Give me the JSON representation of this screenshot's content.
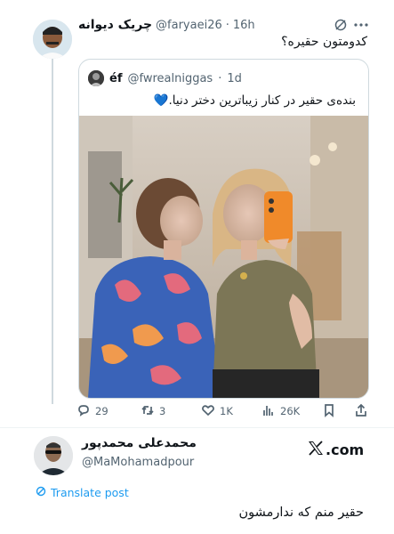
{
  "post": {
    "display_name": "چریک دیوانه",
    "handle": "@faryaei26",
    "separator": "·",
    "time": "16h",
    "text": "کدومتون حقیره؟",
    "grok_icon": "grok-icon",
    "more_icon": "more-dots-icon"
  },
  "quote": {
    "display_name": "éf",
    "handle": "@fwrealniggas",
    "separator": "·",
    "time": "1d",
    "text": "بنده‌ی حقیر در کنار زیباترین دختر دنیا.💙"
  },
  "actions": {
    "replies": "29",
    "reposts": "3",
    "likes": "1K",
    "views": "26K",
    "icons": [
      "reply-icon",
      "repost-icon",
      "like-icon",
      "views-icon",
      "bookmark-icon",
      "share-icon"
    ]
  },
  "reply": {
    "display_name": "محمدعلی محمدپور",
    "handle": "@MaMohamadpour",
    "brand": ".com",
    "translate_label": "Translate post",
    "text": "حقیر منم که ندارمشون"
  },
  "colors": {
    "link": "#1d9bf0",
    "muted": "#536471",
    "border": "#cfd9de"
  }
}
